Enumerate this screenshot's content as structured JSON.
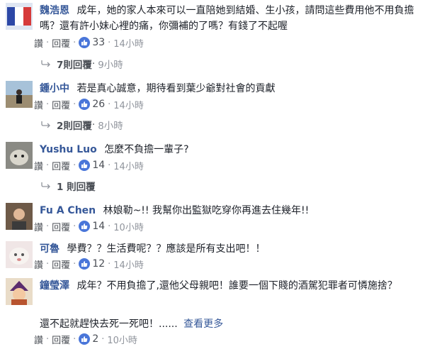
{
  "labels": {
    "like": "讚",
    "reply": "回覆",
    "see_more": "查看更多"
  },
  "colors": {
    "author_link": "#365899",
    "like_badge": "#4a76d9",
    "meta_text": "#90949c"
  },
  "comments": [
    {
      "author": "魏浩恩",
      "text": "成年，她的家人本來可以一直陪她到結婚、生小孩，請問這些費用他不用負擔嗎？還有許小妹心裡的痛，你彌補的了嗎？有錢了不起喔",
      "likes": "33",
      "time": "14小時",
      "replies_label": "7則回覆",
      "replies_time": "9小時",
      "avatar": "flag-avatar"
    },
    {
      "author": "鍾小中",
      "text": "若是真心誠意，期待看到葉少爺對社會的貢獻",
      "likes": "26",
      "time": "14小時",
      "replies_label": "2則回覆",
      "replies_time": "8小時",
      "avatar": "beach-photo-avatar"
    },
    {
      "author": "Yushu Luo",
      "text": "怎麼不負擔一輩子?",
      "likes": "14",
      "time": "14小時",
      "replies_label": "1 則回覆",
      "replies_time": "",
      "avatar": "cat-avatar"
    },
    {
      "author": "Fu A Chen",
      "text": "林娘勒~!! 我幫你出監獄吃穿你再進去住幾年!!",
      "likes": "14",
      "time": "10小時",
      "avatar": "person-avatar"
    },
    {
      "author": "可魯",
      "text": "學費？？生活費呢？？應該是所有支出吧！！",
      "likes": "12",
      "time": "14小時",
      "avatar": "dog-avatar"
    },
    {
      "author": "鐘瑩澤",
      "text": "成年？不用負擔了,還他父母親吧！誰要一個下賤的酒駕犯罪者可憐施捨？",
      "text2": "還不起就趕快去死一死吧！......",
      "likes": "2",
      "time": "10小時",
      "avatar": "cartoon-avatar"
    }
  ]
}
